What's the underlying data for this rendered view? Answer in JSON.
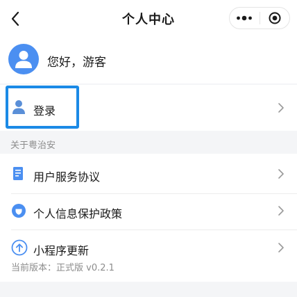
{
  "nav": {
    "title": "个人中心",
    "back_icon": "chevron-left-icon",
    "more_icon": "more-dots-icon",
    "close_icon": "target-close-icon"
  },
  "profile": {
    "greeting": "您好，游客",
    "avatar_icon": "user-avatar-icon",
    "avatar_color": "#4b8ff1"
  },
  "login": {
    "label": "登录",
    "icon": "person-icon",
    "highlight_color": "#1b8ae6"
  },
  "about": {
    "section_title": "关于粤治安",
    "items": [
      {
        "label": "用户服务协议",
        "icon": "document-icon"
      },
      {
        "label": "个人信息保护政策",
        "icon": "shield-icon"
      },
      {
        "label": "小程序更新",
        "icon": "upload-arrow-icon",
        "subtext": "当前版本：正式版 v0.2.1"
      }
    ]
  },
  "colors": {
    "accent": "#4b8ff1",
    "background": "#f4f5f7",
    "muted_text": "#8c8c8c"
  }
}
